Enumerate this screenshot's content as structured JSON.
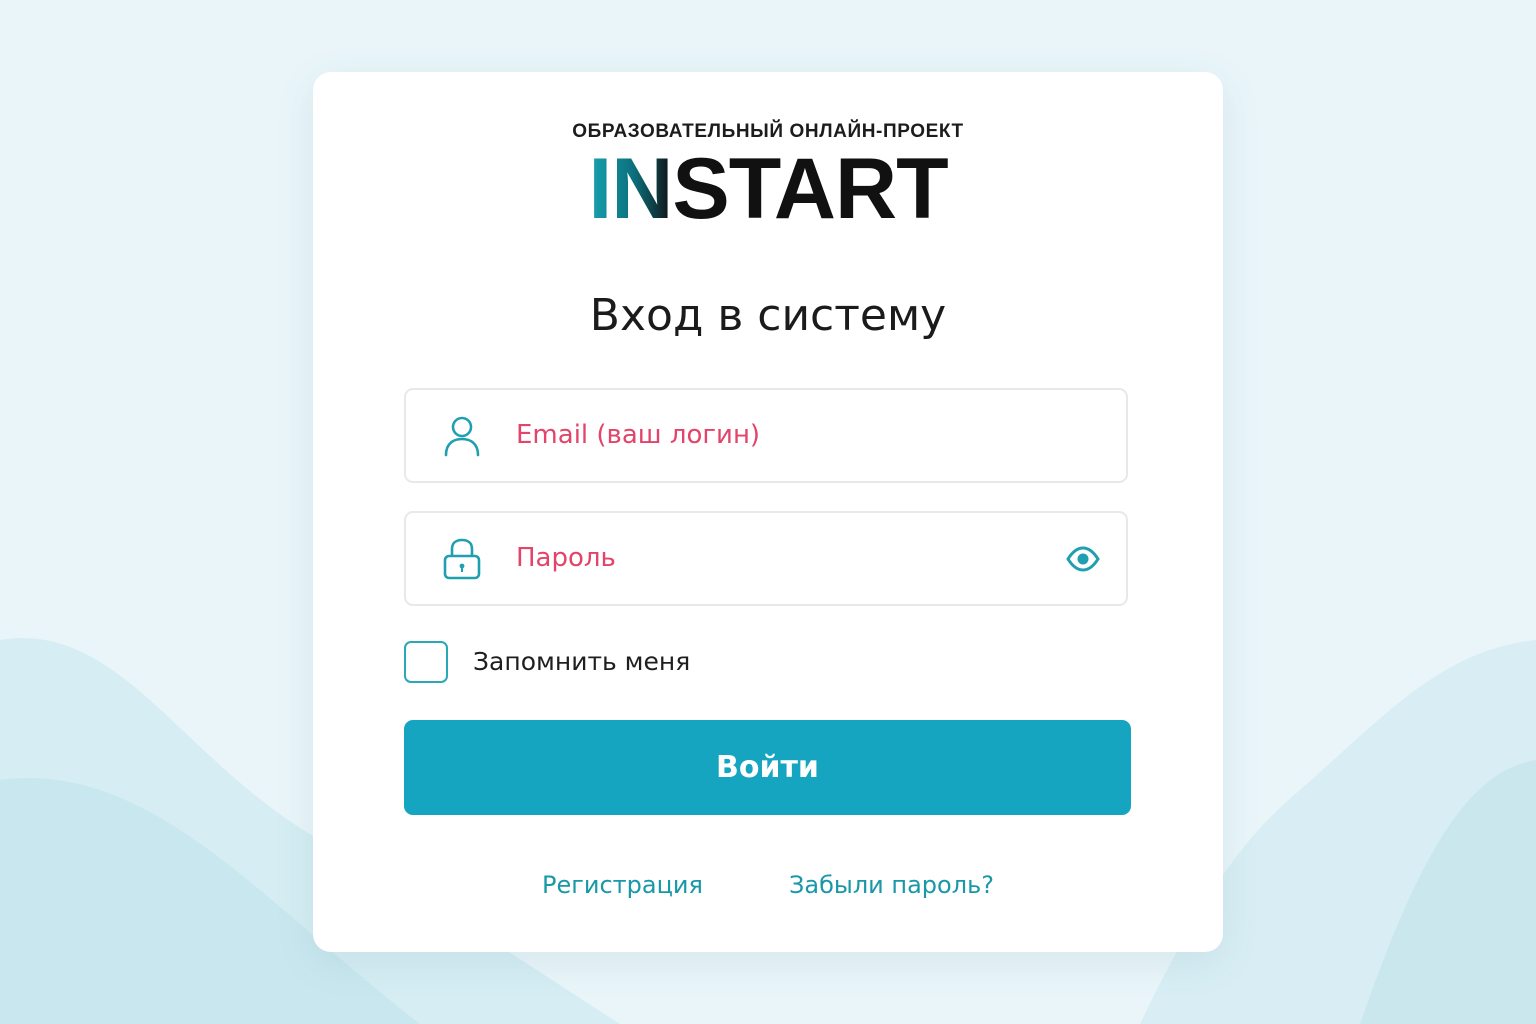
{
  "logo": {
    "subtitle": "ОБРАЗОВАТЕЛЬНЫЙ ОНЛАЙН-ПРОЕКТ",
    "name_accent": "IN",
    "name_rest": "START"
  },
  "page_title": "Вход в систему",
  "form": {
    "email_placeholder": "Email (ваш логин)",
    "password_placeholder": "Пароль",
    "remember_label": "Запомнить меня",
    "submit_label": "Войти"
  },
  "links": {
    "register": "Регистрация",
    "forgot_password": "Забыли пароль?"
  },
  "icons": {
    "email_field": "user-icon",
    "password_field": "lock-icon",
    "password_toggle": "eye-icon"
  },
  "colors": {
    "accent": "#16a5c1",
    "icon": "#1f9fb0",
    "placeholder": "#e3446a",
    "link": "#1898a8"
  }
}
